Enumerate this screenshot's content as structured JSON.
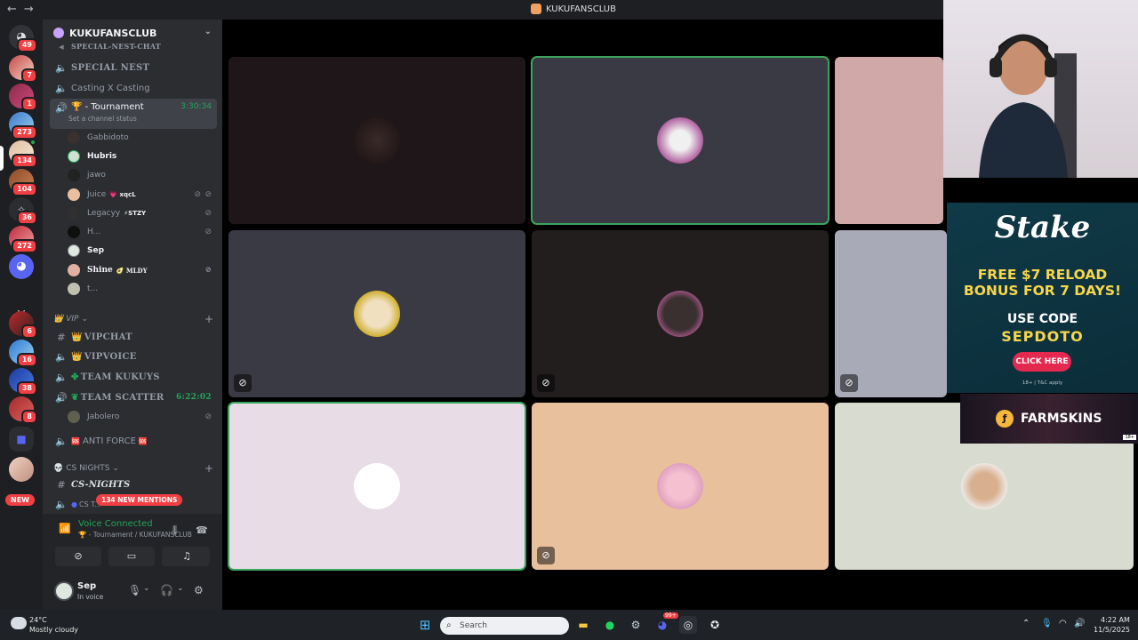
{
  "window": {
    "title": "KUKUFANSCLUB",
    "back_glyph": "←",
    "forward_glyph": "→"
  },
  "rail": {
    "badges": [
      "49",
      "7",
      "1",
      "273",
      "134",
      "104",
      "36",
      "272",
      "6",
      "16",
      "38",
      "8"
    ],
    "letter": "V",
    "new_label": "NEW"
  },
  "guild": {
    "name": "KUKUFANSCLUB"
  },
  "channels": {
    "truncated_top": "SPECIAL-NEST-CHAT",
    "special_nest": "SPECIAL NEST",
    "casting": "Casting X Casting",
    "tournament": "- Tournament",
    "tournament_timer": "3:30:34",
    "tournament_status": "Set a channel status",
    "members": [
      {
        "name": "Gabbidoto",
        "tag": ""
      },
      {
        "name": "Hubris",
        "tag": ""
      },
      {
        "name": "jawo",
        "tag": ""
      },
      {
        "name": "Juice",
        "tag": "xqcL"
      },
      {
        "name": "Legacyy",
        "tag": "STZY"
      },
      {
        "name": "H...",
        "tag": ""
      },
      {
        "name": "Sep",
        "tag": ""
      },
      {
        "name": "Shine",
        "tag": "MLDY"
      },
      {
        "name": "t...",
        "tag": ""
      }
    ],
    "vip_category": "VIP",
    "vipchat": "VIPCHAT",
    "vipvoice": "VIPVOICE",
    "team_kukuys": "TEAM KUKUYS",
    "team_scatter": "TEAM SCATTER",
    "team_scatter_timer": "6:22:02",
    "jabolero": "Jabolero",
    "anti_force": "ANTI FORCE",
    "cs_nights_category": "CS NIGHTS",
    "cs_nights": "CS-NIGHTS",
    "cs_truncated": "CS T...",
    "mentions": "134 NEW MENTIONS"
  },
  "voice": {
    "status": "Voice Connected",
    "channel": "- Tournament / KUKUFANSCLUB"
  },
  "user": {
    "name": "Sep",
    "status": "In voice"
  },
  "ads": {
    "stake_logo": "Stake",
    "promo_line1": "FREE $7 RELOAD",
    "promo_line2": "BONUS FOR 7 DAYS!",
    "use_code": "USE CODE",
    "code": "SEPDOTO",
    "cta": "CLICK HERE",
    "fine_print": "18+ | T&C apply",
    "farmskins": "FARMSKINS",
    "farmskins_age": "18+"
  },
  "taskbar": {
    "temp": "24°C",
    "condition": "Mostly cloudy",
    "search_placeholder": "Search",
    "discord_badge": "99+",
    "time": "4:22 AM",
    "date": "11/5/2025"
  },
  "colors": {
    "accent_green": "#23a55a",
    "mention_red": "#f23f43",
    "stake_yellow": "#f7d64b",
    "stake_cta": "#e3294f"
  }
}
